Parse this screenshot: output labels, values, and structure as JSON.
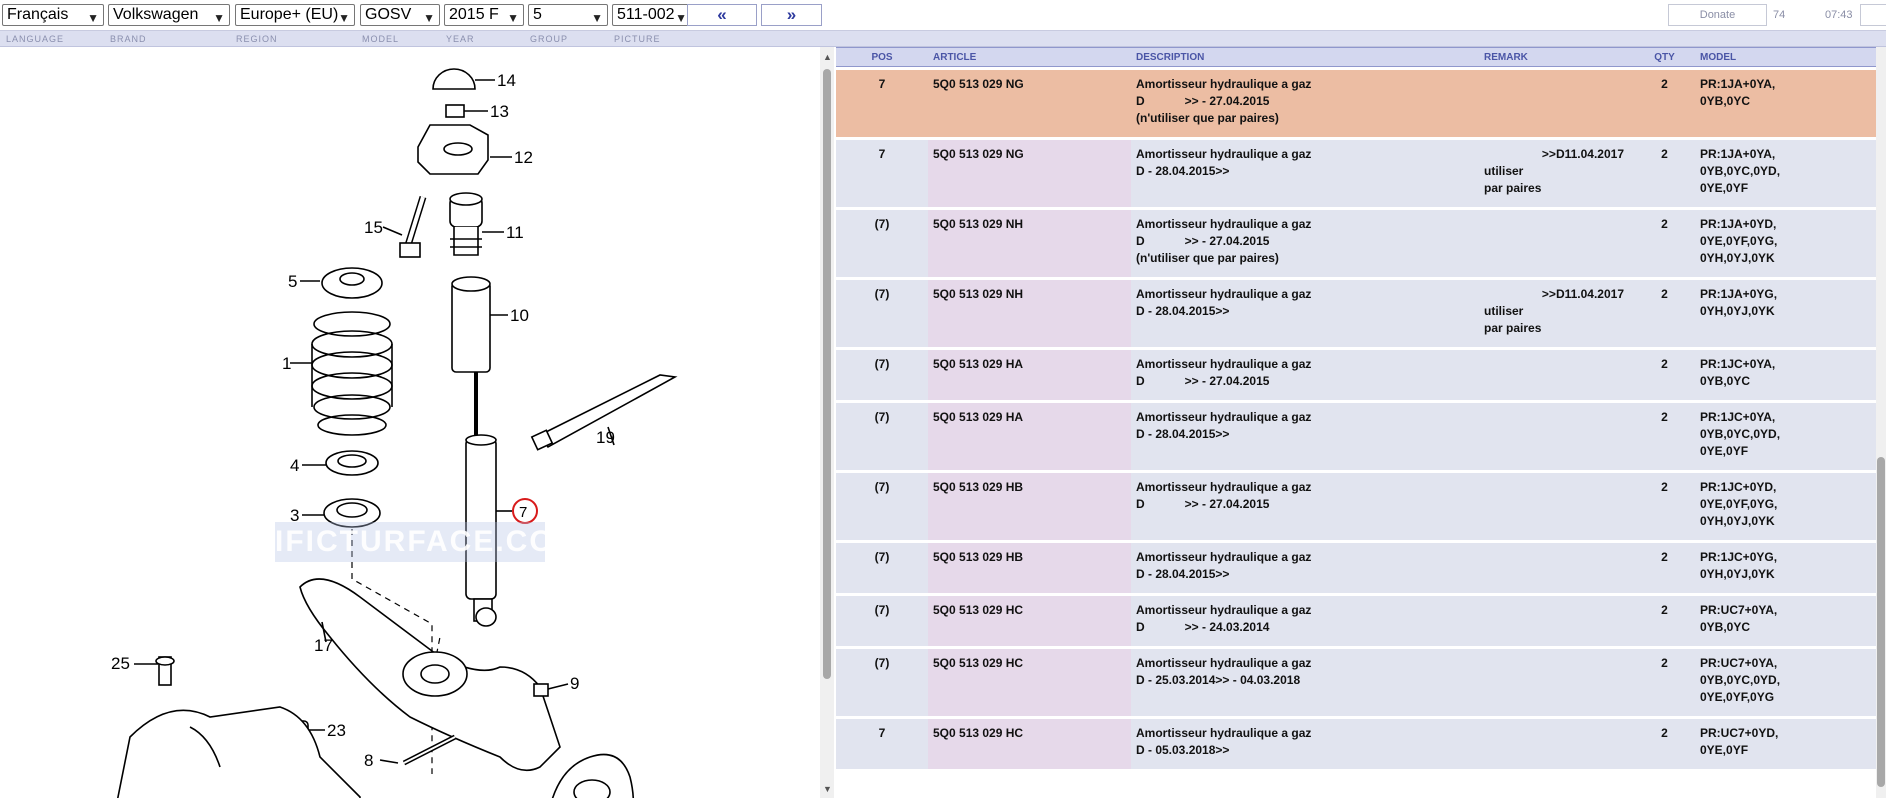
{
  "toolbar": {
    "language": "Français",
    "brand": "Volkswagen",
    "region": "Europe+ (EU)",
    "model": "GOSV",
    "year": "2015  F",
    "group": "5",
    "picture": "511-002",
    "prev_label": "«",
    "next_label": "»",
    "donate_label": "Donate",
    "counter": "74",
    "clock": "07:43"
  },
  "labels": {
    "language": "LANGUAGE",
    "brand": "BRAND",
    "region": "REGION",
    "model": "MODEL",
    "year": "YEAR",
    "group": "GROUP",
    "picture": "PICTURE"
  },
  "diagram": {
    "watermark": "IFICTURFACE.COM",
    "callouts": [
      "14",
      "13",
      "12",
      "15",
      "11",
      "5",
      "10",
      "1",
      "19",
      "4",
      "7",
      "3",
      "17",
      "25",
      "9",
      "23",
      "8"
    ],
    "selected_callout": "7"
  },
  "table": {
    "headers": {
      "pos": "POS",
      "article": "ARTICLE",
      "description": "DESCRIPTION",
      "remark": "REMARK",
      "qty": "QTY",
      "model": "MODEL"
    },
    "rows": [
      {
        "pos": "7",
        "article": "5Q0 513 029 NG",
        "desc": [
          "Amortisseur hydraulique a gaz",
          "D            >> - 27.04.2015",
          "(n'utiliser que par paires)"
        ],
        "remark_right": "",
        "remark_lines": [],
        "qty": "2",
        "model": [
          "PR:1JA+0YA,",
          "0YB,0YC"
        ],
        "highlight": true
      },
      {
        "pos": "7",
        "article": "5Q0 513 029 NG",
        "desc": [
          "Amortisseur hydraulique a gaz",
          "D - 28.04.2015>>"
        ],
        "remark_right": ">>D11.04.2017",
        "remark_lines": [
          "utiliser",
          "par paires"
        ],
        "qty": "2",
        "model": [
          "PR:1JA+0YA,",
          "0YB,0YC,0YD,",
          "0YE,0YF"
        ],
        "highlight": false
      },
      {
        "pos": "(7)",
        "article": "5Q0 513 029 NH",
        "desc": [
          "Amortisseur hydraulique a gaz",
          "D            >> - 27.04.2015",
          "(n'utiliser que par paires)"
        ],
        "remark_right": "",
        "remark_lines": [],
        "qty": "2",
        "model": [
          "PR:1JA+0YD,",
          "0YE,0YF,0YG,",
          "0YH,0YJ,0YK"
        ],
        "highlight": false
      },
      {
        "pos": "(7)",
        "article": "5Q0 513 029 NH",
        "desc": [
          "Amortisseur hydraulique a gaz",
          "D - 28.04.2015>>"
        ],
        "remark_right": ">>D11.04.2017",
        "remark_lines": [
          "utiliser",
          "par paires"
        ],
        "qty": "2",
        "model": [
          "PR:1JA+0YG,",
          "0YH,0YJ,0YK"
        ],
        "highlight": false
      },
      {
        "pos": "(7)",
        "article": "5Q0 513 029 HA",
        "desc": [
          "Amortisseur hydraulique a gaz",
          "D            >> - 27.04.2015"
        ],
        "remark_right": "",
        "remark_lines": [],
        "qty": "2",
        "model": [
          "PR:1JC+0YA,",
          "0YB,0YC"
        ],
        "highlight": false
      },
      {
        "pos": "(7)",
        "article": "5Q0 513 029 HA",
        "desc": [
          "Amortisseur hydraulique a gaz",
          "D - 28.04.2015>>"
        ],
        "remark_right": "",
        "remark_lines": [],
        "qty": "2",
        "model": [
          "PR:1JC+0YA,",
          "0YB,0YC,0YD,",
          "0YE,0YF"
        ],
        "highlight": false
      },
      {
        "pos": "(7)",
        "article": "5Q0 513 029 HB",
        "desc": [
          "Amortisseur hydraulique a gaz",
          "D            >> - 27.04.2015"
        ],
        "remark_right": "",
        "remark_lines": [],
        "qty": "2",
        "model": [
          "PR:1JC+0YD,",
          "0YE,0YF,0YG,",
          "0YH,0YJ,0YK"
        ],
        "highlight": false
      },
      {
        "pos": "(7)",
        "article": "5Q0 513 029 HB",
        "desc": [
          "Amortisseur hydraulique a gaz",
          "D - 28.04.2015>>"
        ],
        "remark_right": "",
        "remark_lines": [],
        "qty": "2",
        "model": [
          "PR:1JC+0YG,",
          "0YH,0YJ,0YK"
        ],
        "highlight": false
      },
      {
        "pos": "(7)",
        "article": "5Q0 513 029 HC",
        "desc": [
          "Amortisseur hydraulique a gaz",
          "D            >> - 24.03.2014"
        ],
        "remark_right": "",
        "remark_lines": [],
        "qty": "2",
        "model": [
          "PR:UC7+0YA,",
          "0YB,0YC"
        ],
        "highlight": false
      },
      {
        "pos": "(7)",
        "article": "5Q0 513 029 HC",
        "desc": [
          "Amortisseur hydraulique a gaz",
          "D - 25.03.2014>> - 04.03.2018"
        ],
        "remark_right": "",
        "remark_lines": [],
        "qty": "2",
        "model": [
          "PR:UC7+0YA,",
          "0YB,0YC,0YD,",
          "0YE,0YF,0YG"
        ],
        "highlight": false
      },
      {
        "pos": "7",
        "article": "5Q0 513 029 HC",
        "desc": [
          "Amortisseur hydraulique a gaz",
          "D - 05.03.2018>>"
        ],
        "remark_right": "",
        "remark_lines": [],
        "qty": "2",
        "model": [
          "PR:UC7+0YD,",
          "0YE,0YF"
        ],
        "highlight": false
      }
    ]
  }
}
